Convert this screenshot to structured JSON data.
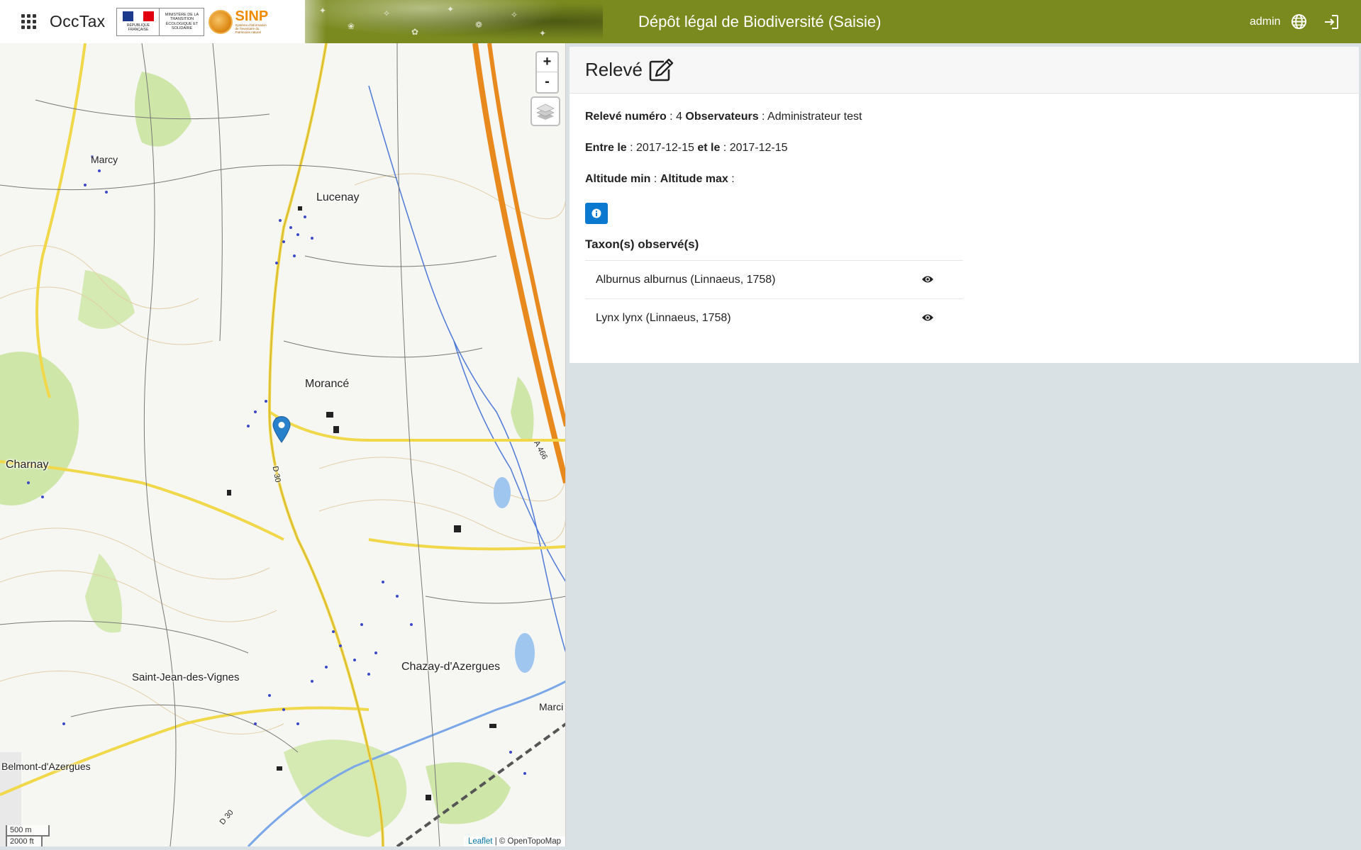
{
  "header": {
    "app_name": "OccTax",
    "logo_ministry_left": "RÉPUBLIQUE FRANÇAISE",
    "logo_ministry_right": "MINISTÈRE DE LA TRANSITION ÉCOLOGIQUE ET SOLIDAIRE",
    "logo_sinp": "SINP",
    "logo_sinp_sub": "Système d'information de l'inventaire du Patrimoine naturel",
    "site_title": "Dépôt légal de Biodiversité (Saisie)",
    "user": "admin",
    "brand_colors": {
      "bar": "#7a8a1f",
      "sinp": "#f08a00"
    }
  },
  "map": {
    "labels": [
      "Marcy",
      "Lucenay",
      "Morancé",
      "Charnay",
      "Saint-Jean-des-Vignes",
      "Chazay-d'Azergues",
      "Marci",
      "Belmont-d'Azergues"
    ],
    "road_labels": [
      "D 30",
      "D 30",
      "A 466"
    ],
    "zoom_in": "+",
    "zoom_out": "-",
    "scale_metric": "500 m",
    "scale_imperial": "2000 ft",
    "attribution_link": "Leaflet",
    "attribution_text": "| © OpenTopoMap",
    "marker_color": "#2a81cb"
  },
  "releve": {
    "title": "Relevé",
    "numero_label": "Relevé numéro",
    "numero_value": ": 4",
    "observateurs_label": "Observateurs",
    "observateurs_value": ": Administrateur test",
    "entre_label": "Entre le",
    "date_min": ": 2017-12-15",
    "et_label": "et le",
    "date_max": ": 2017-12-15",
    "alt_min_label": "Altitude min",
    "alt_min_value": ":",
    "alt_max_label": "Altitude max",
    "alt_max_value": ":",
    "taxons_title": "Taxon(s) observé(s)",
    "taxons": [
      {
        "name": "Alburnus alburnus (Linnaeus, 1758)"
      },
      {
        "name": "Lynx lynx (Linnaeus, 1758)"
      }
    ],
    "info_button_color": "#0b79d0"
  }
}
